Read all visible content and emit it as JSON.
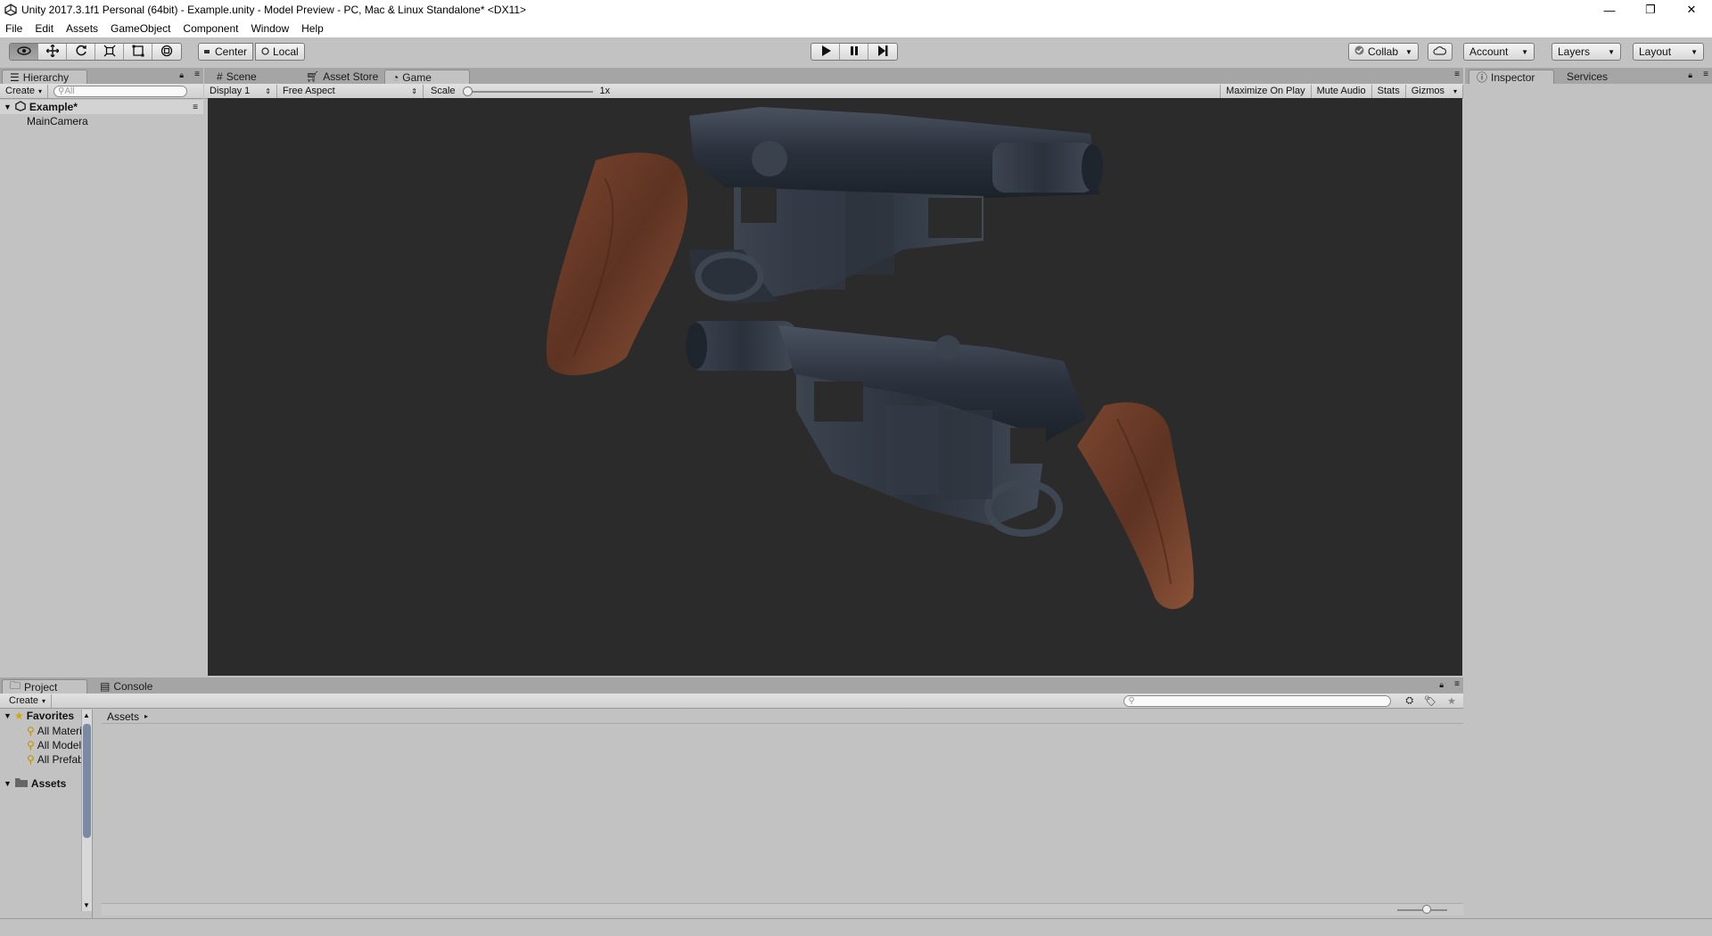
{
  "window": {
    "title": "Unity 2017.3.1f1 Personal (64bit) - Example.unity - Model Preview - PC, Mac & Linux Standalone* <DX11>",
    "minimize": "—",
    "restore": "❐",
    "close": "✕"
  },
  "menu": {
    "items": [
      "File",
      "Edit",
      "Assets",
      "GameObject",
      "Component",
      "Window",
      "Help"
    ]
  },
  "toolbar": {
    "tools": [
      "view-tool",
      "move-tool",
      "rotate-tool",
      "scale-tool",
      "rect-tool",
      "transform-tool"
    ],
    "pivot_label": "Center",
    "space_label": "Local",
    "collab_label": "Collab",
    "account_label": "Account",
    "layers_label": "Layers",
    "layout_label": "Layout"
  },
  "hierarchy": {
    "tab_label": "Hierarchy",
    "create_label": "Create",
    "search_placeholder": "All",
    "scene_name": "Example*",
    "items": [
      "MainCamera"
    ]
  },
  "center": {
    "tabs": [
      "Scene",
      "Asset Store",
      "Game"
    ],
    "active_tab": "Game",
    "display_label": "Display 1",
    "aspect_label": "Free Aspect",
    "scale_label": "Scale",
    "scale_value": "1x",
    "scale_fraction": 0.0,
    "toggles": [
      "Maximize On Play",
      "Mute Audio",
      "Stats",
      "Gizmos"
    ]
  },
  "inspector": {
    "tabs": [
      "Inspector",
      "Services"
    ]
  },
  "project": {
    "tabs": [
      "Project",
      "Console"
    ],
    "create_label": "Create",
    "favorites_label": "Favorites",
    "favorites": [
      "All Materi",
      "All Model",
      "All Prefab"
    ],
    "assets_label": "Assets",
    "breadcrumb": "Assets"
  },
  "colors": {
    "editor_bg": "#c2c2c2",
    "viewport_bg": "#2b2b2b",
    "wood": "#6b3a26",
    "metal": "#2e3540"
  }
}
